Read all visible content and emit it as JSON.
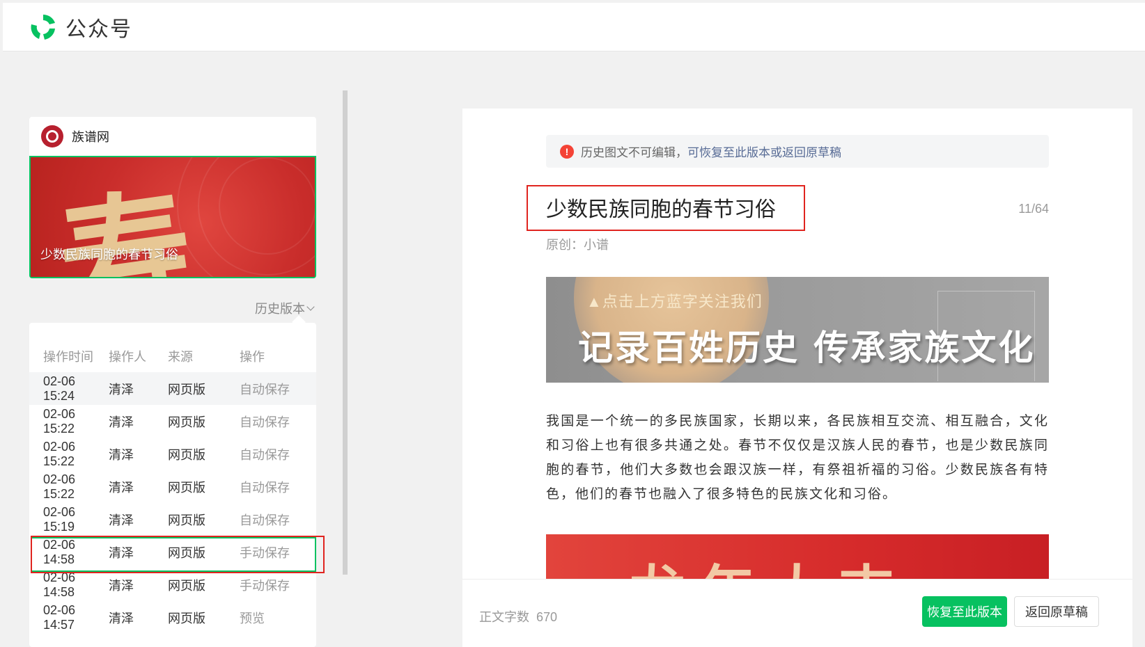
{
  "header": {
    "title": "公众号"
  },
  "account": {
    "name": "族谱网"
  },
  "cover": {
    "title": "少数民族同胞的春节习俗"
  },
  "history": {
    "toggle_label": "历史版本",
    "columns": [
      "操作时间",
      "操作人",
      "来源",
      "操作"
    ],
    "rows": [
      {
        "time": "02-06 15:24",
        "user": "清泽",
        "source": "网页版",
        "action": "自动保存"
      },
      {
        "time": "02-06 15:22",
        "user": "清泽",
        "source": "网页版",
        "action": "自动保存"
      },
      {
        "time": "02-06 15:22",
        "user": "清泽",
        "source": "网页版",
        "action": "自动保存"
      },
      {
        "time": "02-06 15:22",
        "user": "清泽",
        "source": "网页版",
        "action": "自动保存"
      },
      {
        "time": "02-06 15:19",
        "user": "清泽",
        "source": "网页版",
        "action": "自动保存"
      },
      {
        "time": "02-06 14:58",
        "user": "清泽",
        "source": "网页版",
        "action": "手动保存"
      },
      {
        "time": "02-06 14:58",
        "user": "清泽",
        "source": "网页版",
        "action": "手动保存"
      },
      {
        "time": "02-06 14:57",
        "user": "清泽",
        "source": "网页版",
        "action": "预览"
      }
    ]
  },
  "preview": {
    "notice_text": "历史图文不可编辑，",
    "notice_link": "可恢复至此版本或返回原草稿",
    "warn_symbol": "!",
    "title": "少数民族同胞的春节习俗",
    "title_count": "11/64",
    "byline": "原创：小谱",
    "banner_sub": "▲点击上方蓝字关注我们",
    "banner_main": "记录百姓历史 传承家族文化",
    "body": "我国是一个统一的多民族国家，长期以来，各民族相互交流、相互融合，文化和习俗上也有很多共通之处。春节不仅仅是汉族人民的春节，也是少数民族同胞的春节，他们大多数也会跟汉族一样，有祭祖祈福的习俗。少数民族各有特色，他们的春节也融入了很多特色的民族文化和习俗。",
    "red_banner_text": "龙年大吉"
  },
  "footer": {
    "wordcount_label": "正文字数",
    "wordcount_value": "670",
    "restore_button": "恢复至此版本",
    "back_button": "返回原草稿"
  },
  "colors": {
    "brand_green": "#07c160",
    "highlight_red": "#e0241f",
    "link_blue": "#576b95"
  }
}
